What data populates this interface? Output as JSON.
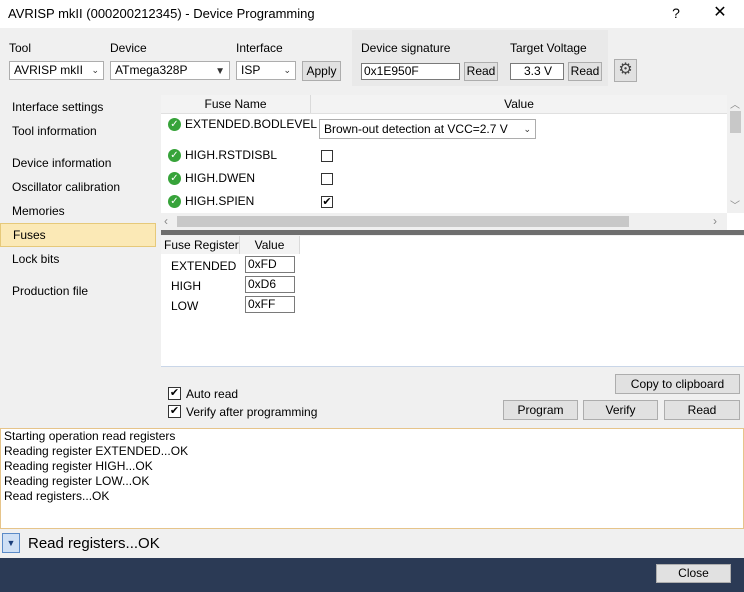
{
  "window": {
    "title": "AVRISP mkII (000200212345) - Device Programming",
    "help": "?",
    "close": "✕"
  },
  "toolbar": {
    "tool_label": "Tool",
    "tool_value": "AVRISP mkII",
    "device_label": "Device",
    "device_value": "ATmega328P",
    "interface_label": "Interface",
    "interface_value": "ISP",
    "apply_label": "Apply",
    "signature_label": "Device signature",
    "signature_value": "0x1E950F",
    "signature_read": "Read",
    "voltage_label": "Target Voltage",
    "voltage_value": "3.3 V",
    "voltage_read": "Read"
  },
  "sidebar": {
    "items": [
      {
        "label": "Interface settings"
      },
      {
        "label": "Tool information"
      },
      {
        "label": "Device information"
      },
      {
        "label": "Oscillator calibration"
      },
      {
        "label": "Memories"
      },
      {
        "label": "Fuses"
      },
      {
        "label": "Lock bits"
      },
      {
        "label": "Production file"
      }
    ],
    "selected": "Fuses"
  },
  "fuses": {
    "col_name": "Fuse Name",
    "col_value": "Value",
    "rows": [
      {
        "name": "EXTENDED.BODLEVEL",
        "value": "Brown-out detection at VCC=2.7 V"
      },
      {
        "name": "HIGH.RSTDISBL",
        "checked": false
      },
      {
        "name": "HIGH.DWEN",
        "checked": false
      },
      {
        "name": "HIGH.SPIEN",
        "checked": true,
        "mark": "✔"
      }
    ]
  },
  "registers": {
    "col_register": "Fuse Register",
    "col_value": "Value",
    "rows": [
      {
        "name": "EXTENDED",
        "value": "0xFD"
      },
      {
        "name": "HIGH",
        "value": "0xD6"
      },
      {
        "name": "LOW",
        "value": "0xFF"
      }
    ]
  },
  "options": {
    "auto_read": "Auto read",
    "verify": "Verify after programming",
    "copy": "Copy to clipboard",
    "program": "Program",
    "verify_btn": "Verify",
    "read": "Read"
  },
  "log": [
    "Starting operation read registers",
    "Reading register EXTENDED...OK",
    "Reading register HIGH...OK",
    "Reading register LOW...OK",
    "Read registers...OK"
  ],
  "status": {
    "text": "Read registers...OK"
  },
  "footer": {
    "close": "Close"
  },
  "colors": {
    "selected_bg": "#fbe9b6",
    "bottom_bar": "#2b3a55",
    "ok_green": "#37a33a"
  }
}
